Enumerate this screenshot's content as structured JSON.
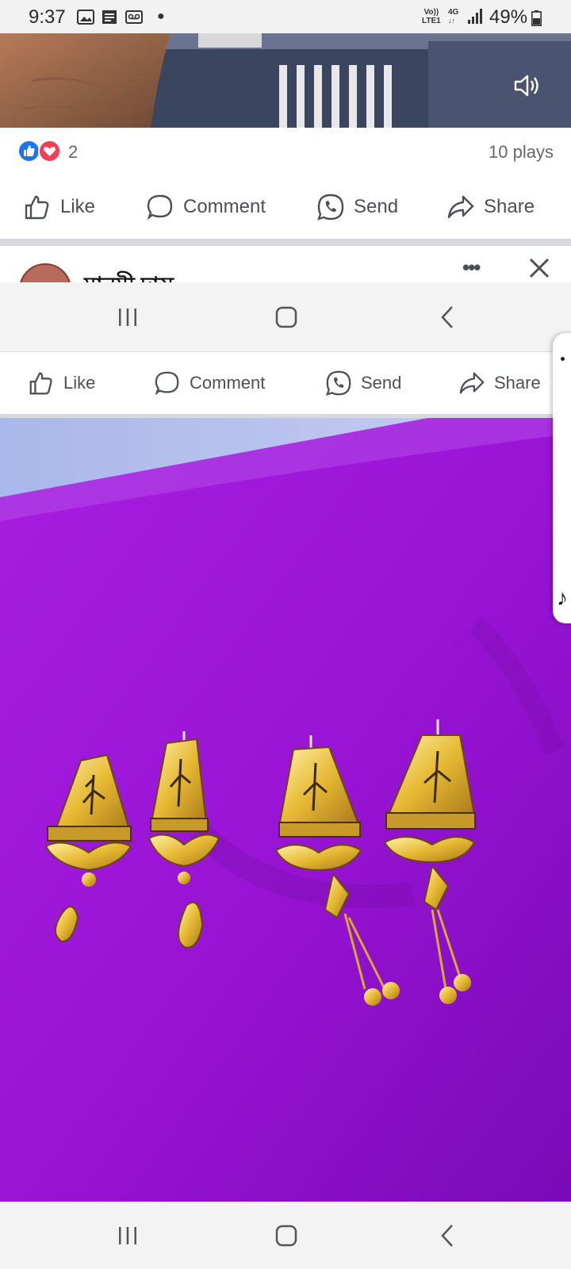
{
  "status_bar": {
    "time": "9:37",
    "network_top": "Vo))",
    "network_bottom": "LTE1",
    "network_type": "4G",
    "battery": "49%"
  },
  "video": {
    "volume_icon": "volume-icon"
  },
  "reactions": {
    "count": "2",
    "plays": "10 plays",
    "like_color": "#1877f2",
    "love_color": "#f33e58"
  },
  "actions": {
    "like": "Like",
    "comment": "Comment",
    "send": "Send",
    "share": "Share"
  },
  "next_post": {
    "author": "মানমী দাস"
  },
  "colors": {
    "accent": "#1877f2",
    "photo_background": "#9a14d6"
  }
}
